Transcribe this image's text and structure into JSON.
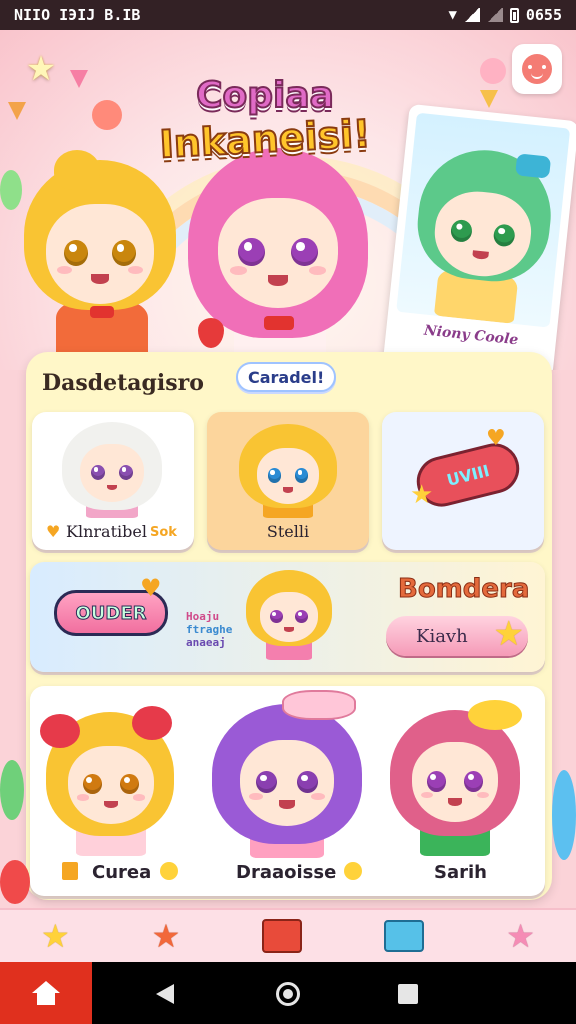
{
  "status_bar": {
    "left_text": "NIIO  IЭIJ B.IB",
    "time": "0655"
  },
  "hero": {
    "title_line1": "Copiaa",
    "title_line2": "Inkaneisi!",
    "featured_card_label": "Niony Coole"
  },
  "panel": {
    "title": "Dasdetagisro",
    "cancel_label": "Caradel!",
    "tiles": [
      {
        "label": "Klnratibel",
        "extra": "Sok"
      },
      {
        "label": "Stelli"
      },
      {
        "badge_text": "UVIII"
      }
    ],
    "banner": {
      "pill_text": "OUDER",
      "handwriting": [
        "Hoaju",
        "ftraghe",
        "anaeaj"
      ],
      "title": "Bomdera",
      "button_label": "Kiavh"
    },
    "characters": [
      {
        "label": "Curea"
      },
      {
        "label": "Draaoisse"
      },
      {
        "label": "Sarih"
      }
    ]
  },
  "tab_bar": {
    "icons": [
      "star-icon",
      "orange-star-icon",
      "gift-box-icon",
      "toolbox-icon",
      "pink-star-icon"
    ]
  },
  "colors": {
    "accent_pink": "#f16f9f",
    "accent_yellow": "#ffd23a",
    "nav_home": "#e0301e"
  }
}
